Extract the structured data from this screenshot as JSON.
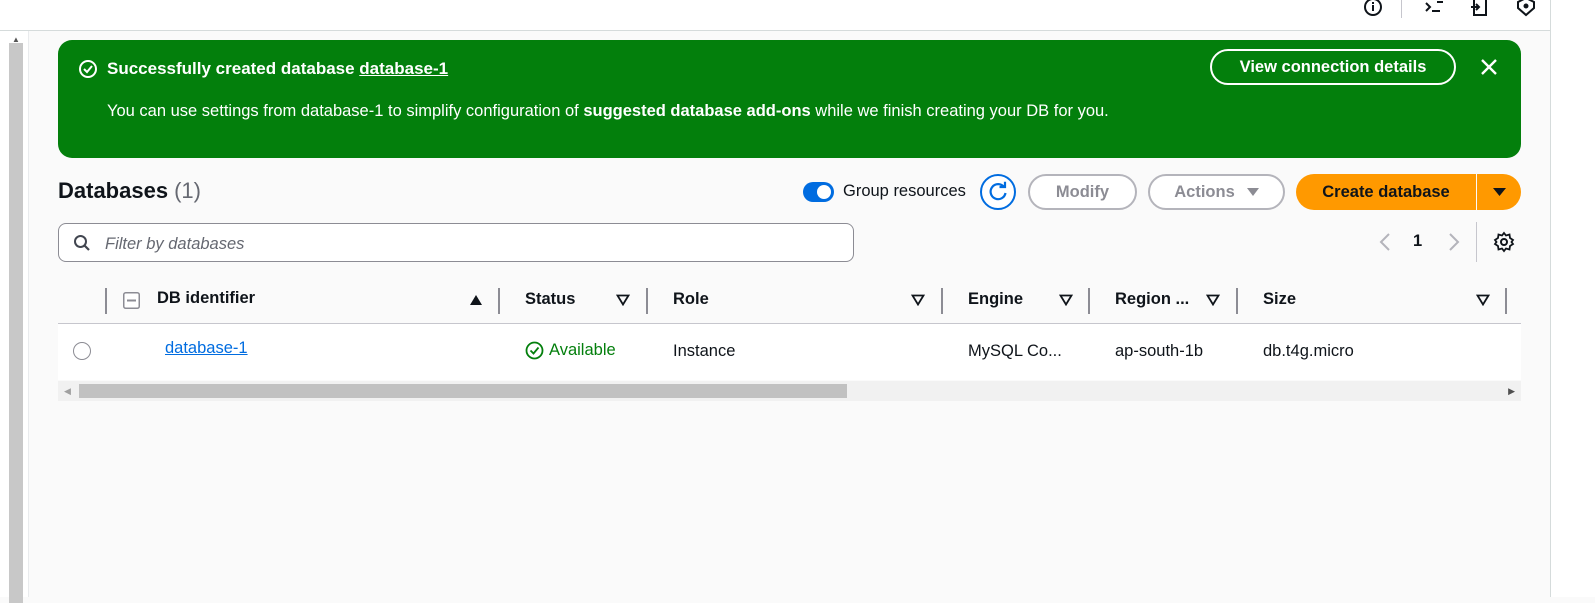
{
  "flash": {
    "headline_prefix": "Successfully created database ",
    "headline_link": "database-1",
    "body_pre": "You can use settings from database-1 to simplify configuration of ",
    "body_bold": "suggested database add-ons",
    "body_post": " while we finish creating your DB for you.",
    "view_button": "View connection details",
    "color": "#037f0c"
  },
  "header": {
    "title": "Databases",
    "count": "(1)",
    "group_toggle_label": "Group resources",
    "group_toggle_on": true,
    "modify_label": "Modify",
    "actions_label": "Actions",
    "create_label": "Create database",
    "accent": "#ff9900"
  },
  "filter": {
    "placeholder": "Filter by databases",
    "value": ""
  },
  "pagination": {
    "current_page": "1"
  },
  "table": {
    "columns": [
      "DB identifier",
      "Status",
      "Role",
      "Engine",
      "Region ...",
      "Size"
    ],
    "rows": [
      {
        "db_identifier": "database-1",
        "status": "Available",
        "role": "Instance",
        "engine": "MySQL Co...",
        "region": "ap-south-1b",
        "size": "db.t4g.micro"
      }
    ]
  },
  "icons": [
    "info-icon",
    "cloudshell-icon",
    "export-icon",
    "shield-icon",
    "check-circle-icon",
    "close-icon",
    "refresh-icon",
    "search-icon",
    "chevron-left-icon",
    "chevron-right-icon",
    "gear-icon",
    "sort-icon",
    "caret-down-icon"
  ]
}
